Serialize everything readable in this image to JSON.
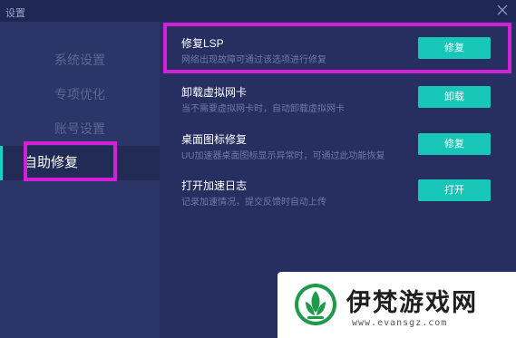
{
  "window": {
    "title": "设置"
  },
  "sidebar": {
    "items": [
      {
        "label": "系统设置",
        "active": false
      },
      {
        "label": "专项优化",
        "active": false
      },
      {
        "label": "账号设置",
        "active": false
      },
      {
        "label": "自助修复",
        "active": true
      }
    ]
  },
  "content": {
    "rows": [
      {
        "title": "修复LSP",
        "desc": "网络出现故障可通过该选项进行修复",
        "button": "修复"
      },
      {
        "title": "卸载虚拟网卡",
        "desc": "当不需要虚拟网卡时，自动卸载虚拟网卡",
        "button": "卸载"
      },
      {
        "title": "桌面图标修复",
        "desc": "UU加速器桌面图标显示异常时，可通过此功能恢复",
        "button": "修复"
      },
      {
        "title": "打开加速日志",
        "desc": "记录加速情况，提交反馈时自动上传",
        "button": "打开"
      }
    ]
  },
  "watermark": {
    "name": "伊梵游戏网",
    "url": "www.evansgz.com"
  },
  "colors": {
    "window_bg": "#262f60",
    "sidebar_bg": "#2c3568",
    "accent": "#19c7b8",
    "highlight": "#d41fd8"
  },
  "icons": {
    "close": "close-icon",
    "logo": "leaf-logo-icon"
  }
}
